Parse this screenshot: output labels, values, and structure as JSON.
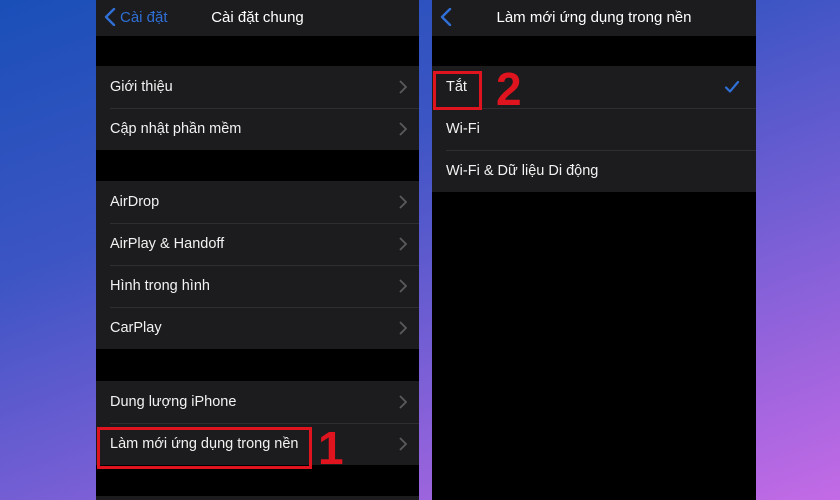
{
  "left_screen": {
    "back_label": "Cài đặt",
    "title": "Cài đặt chung",
    "groups": [
      {
        "items": [
          {
            "label": "Giới thiệu"
          },
          {
            "label": "Cập nhật phần mềm"
          }
        ]
      },
      {
        "items": [
          {
            "label": "AirDrop"
          },
          {
            "label": "AirPlay & Handoff"
          },
          {
            "label": "Hình trong hình"
          },
          {
            "label": "CarPlay"
          }
        ]
      },
      {
        "items": [
          {
            "label": "Dung lượng iPhone"
          },
          {
            "label": "Làm mới ứng dụng trong nền"
          }
        ]
      }
    ],
    "step_number": "1"
  },
  "right_screen": {
    "title": "Làm mới ứng dụng trong nền",
    "options": [
      {
        "label": "Tắt",
        "selected": true
      },
      {
        "label": "Wi-Fi",
        "selected": false
      },
      {
        "label": "Wi-Fi & Dữ liệu Di động",
        "selected": false
      }
    ],
    "step_number": "2"
  },
  "colors": {
    "accent": "#2f6fd6",
    "highlight": "#e0141e",
    "cell_bg": "#1c1c1e"
  }
}
